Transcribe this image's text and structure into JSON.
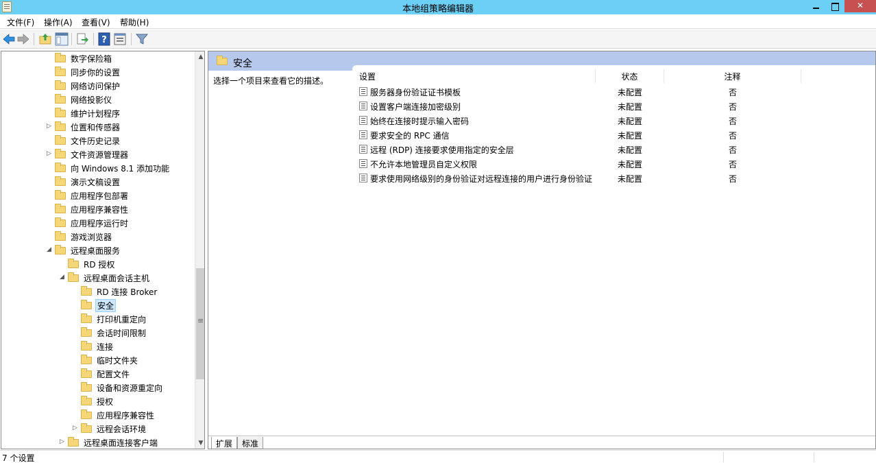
{
  "window": {
    "title": "本地组策略编辑器"
  },
  "menu": [
    "文件(F)",
    "操作(A)",
    "查看(V)",
    "帮助(H)"
  ],
  "toolbar": [
    "back-icon",
    "forward-icon",
    "up-folder-icon",
    "show-hide-tree-icon",
    "export-list-icon",
    "help-icon",
    "properties-icon",
    "filter-icon"
  ],
  "tree": [
    {
      "label": "数字保险箱",
      "arrow": ""
    },
    {
      "label": "同步你的设置",
      "arrow": ""
    },
    {
      "label": "网络访问保护",
      "arrow": ""
    },
    {
      "label": "网络投影仪",
      "arrow": ""
    },
    {
      "label": "维护计划程序",
      "arrow": ""
    },
    {
      "label": "位置和传感器",
      "arrow": "▷"
    },
    {
      "label": "文件历史记录",
      "arrow": ""
    },
    {
      "label": "文件资源管理器",
      "arrow": "▷"
    },
    {
      "label": "向 Windows 8.1 添加功能",
      "arrow": ""
    },
    {
      "label": "演示文稿设置",
      "arrow": ""
    },
    {
      "label": "应用程序包部署",
      "arrow": ""
    },
    {
      "label": "应用程序兼容性",
      "arrow": ""
    },
    {
      "label": "应用程序运行时",
      "arrow": ""
    },
    {
      "label": "游戏浏览器",
      "arrow": ""
    },
    {
      "label": "远程桌面服务",
      "arrow": "◢"
    },
    {
      "label": "RD 授权",
      "arrow": ""
    },
    {
      "label": "远程桌面会话主机",
      "arrow": "◢"
    },
    {
      "label": "RD 连接 Broker",
      "arrow": ""
    },
    {
      "label": "安全",
      "arrow": "",
      "selected": true
    },
    {
      "label": "打印机重定向",
      "arrow": ""
    },
    {
      "label": "会话时间限制",
      "arrow": ""
    },
    {
      "label": "连接",
      "arrow": ""
    },
    {
      "label": "临时文件夹",
      "arrow": ""
    },
    {
      "label": "配置文件",
      "arrow": ""
    },
    {
      "label": "设备和资源重定向",
      "arrow": ""
    },
    {
      "label": "授权",
      "arrow": ""
    },
    {
      "label": "应用程序兼容性",
      "arrow": ""
    },
    {
      "label": "远程会话环境",
      "arrow": "▷"
    },
    {
      "label": "远程桌面连接客户端",
      "arrow": "▷"
    }
  ],
  "right": {
    "heading": "安全",
    "description": "选择一个项目来查看它的描述。",
    "columns": {
      "setting": "设置",
      "state": "状态",
      "note": "注释"
    },
    "rows": [
      {
        "name": "服务器身份验证证书模板",
        "state": "未配置",
        "note": "否"
      },
      {
        "name": "设置客户端连接加密级别",
        "state": "未配置",
        "note": "否"
      },
      {
        "name": "始终在连接时提示输入密码",
        "state": "未配置",
        "note": "否"
      },
      {
        "name": "要求安全的 RPC 通信",
        "state": "未配置",
        "note": "否"
      },
      {
        "name": "远程 (RDP) 连接要求使用指定的安全层",
        "state": "未配置",
        "note": "否"
      },
      {
        "name": "不允许本地管理员自定义权限",
        "state": "未配置",
        "note": "否"
      },
      {
        "name": "要求使用网络级别的身份验证对远程连接的用户进行身份验证",
        "state": "未配置",
        "note": "否"
      }
    ],
    "tabs": [
      "扩展",
      "标准"
    ]
  },
  "status": {
    "text": "7 个设置"
  }
}
